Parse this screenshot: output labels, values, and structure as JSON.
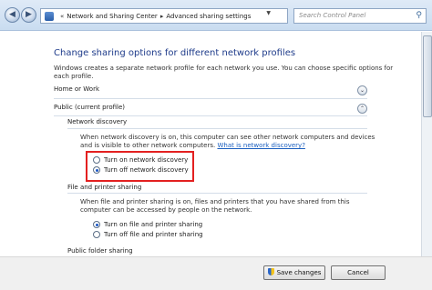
{
  "address_bar": {
    "breadcrumb": [
      "Network and Sharing Center",
      "Advanced sharing settings"
    ],
    "search_placeholder": "Search Control Panel"
  },
  "page": {
    "heading": "Change sharing options for different network profiles",
    "intro": "Windows creates a separate network profile for each network you use. You can choose specific options for each profile."
  },
  "profiles": {
    "home_or_work": "Home or Work",
    "public": "Public (current profile)"
  },
  "network_discovery": {
    "title": "Network discovery",
    "description": "When network discovery is on, this computer can see other network computers and devices and is visible to other network computers.",
    "link": "What is network discovery?",
    "options": [
      {
        "label": "Turn on network discovery",
        "selected": false
      },
      {
        "label": "Turn off network discovery",
        "selected": true
      }
    ]
  },
  "file_printer_sharing": {
    "title": "File and printer sharing",
    "description": "When file and printer sharing is on, files and printers that you have shared from this computer can be accessed by people on the network.",
    "options": [
      {
        "label": "Turn on file and printer sharing",
        "selected": true
      },
      {
        "label": "Turn off file and printer sharing",
        "selected": false
      }
    ]
  },
  "public_folder_sharing": {
    "title": "Public folder sharing"
  },
  "buttons": {
    "save": "Save changes",
    "cancel": "Cancel"
  },
  "colors": {
    "heading": "#1e3b8a",
    "link": "#1b5fbf",
    "highlight": "#e32020"
  }
}
